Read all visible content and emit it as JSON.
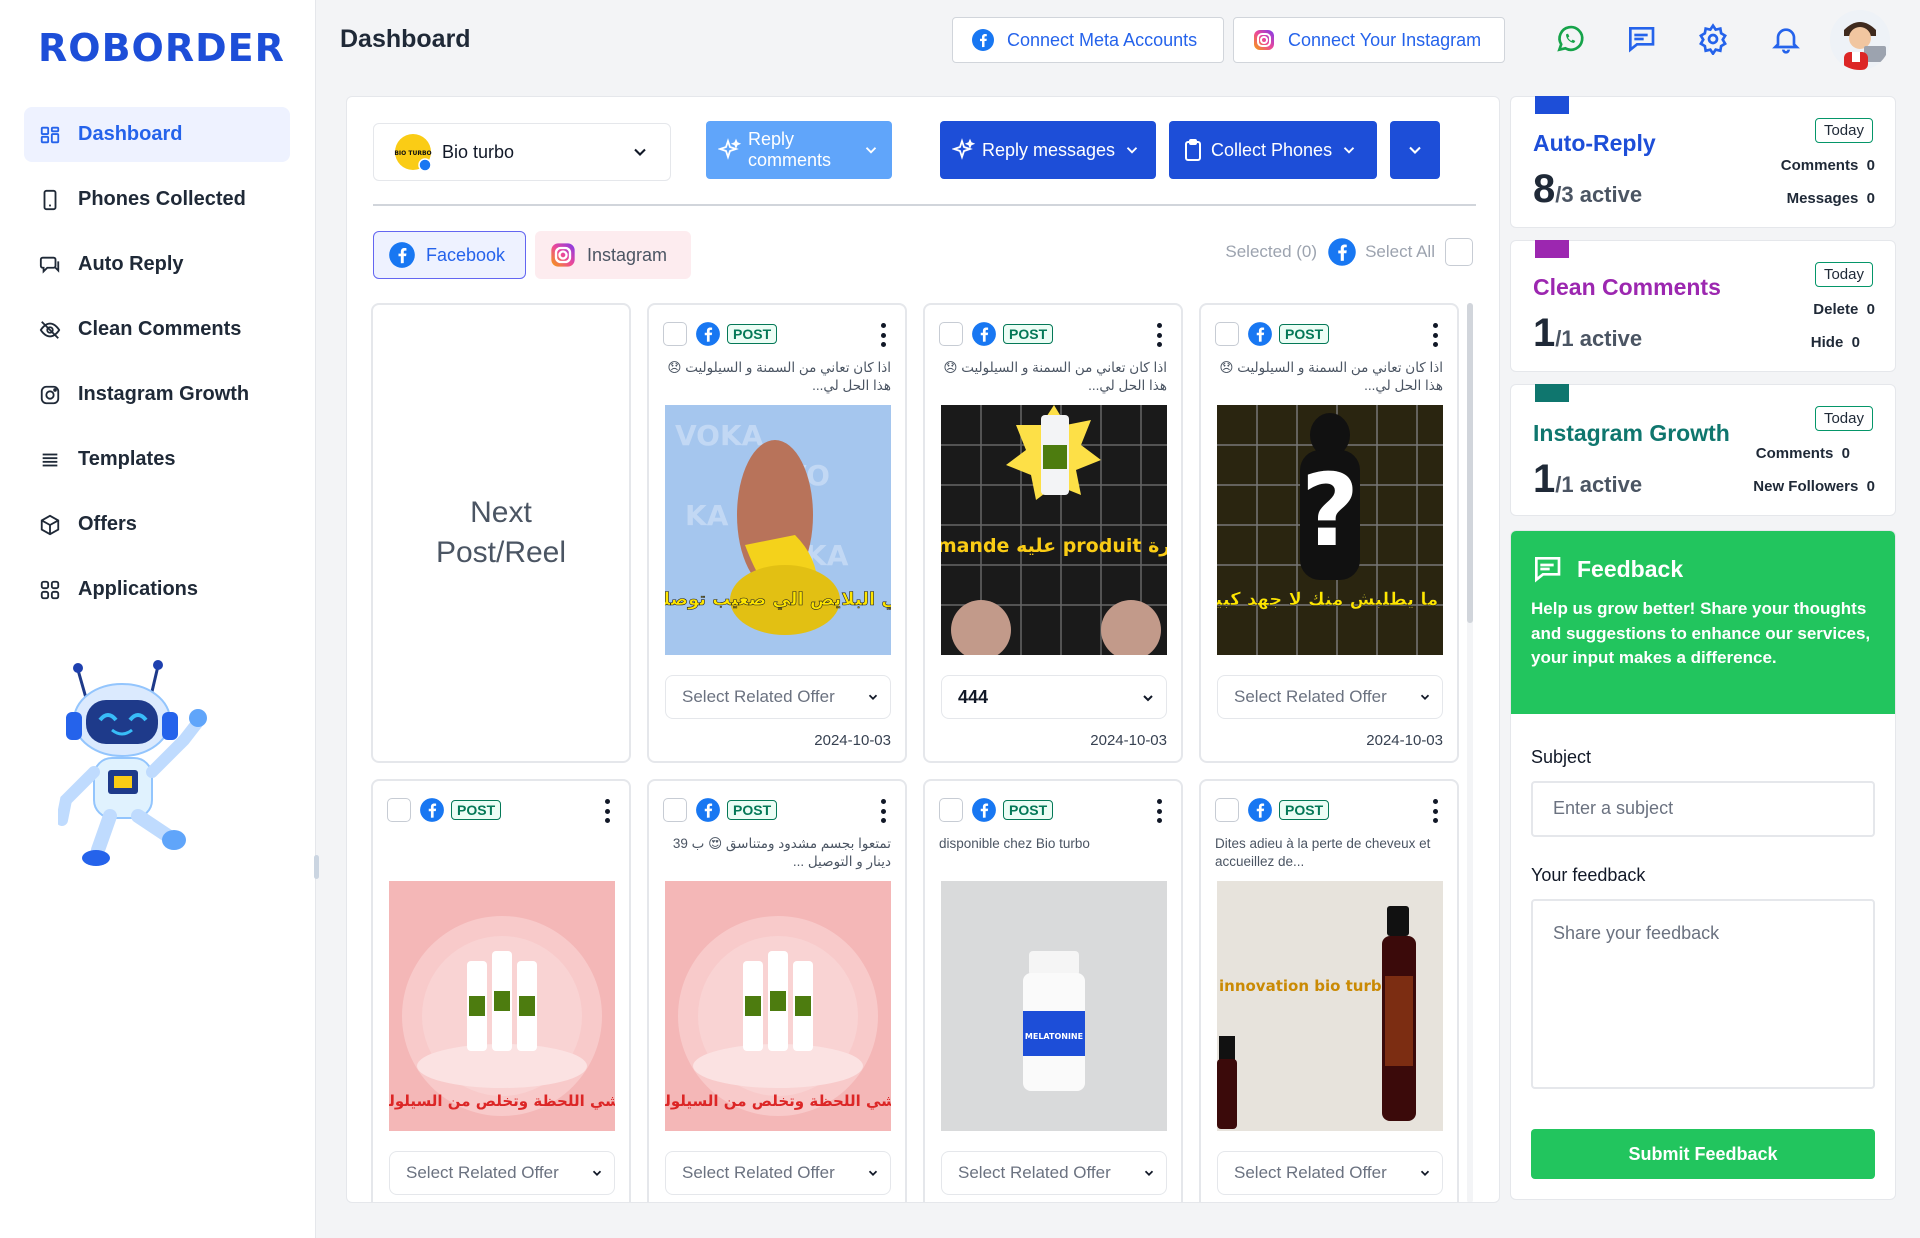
{
  "brand": {
    "name": "ROBORDER"
  },
  "sidebar": {
    "items": [
      {
        "label": "Dashboard",
        "icon": "dashboard-icon",
        "active": true
      },
      {
        "label": "Phones Collected",
        "icon": "phone-icon"
      },
      {
        "label": "Auto Reply",
        "icon": "chat-icon"
      },
      {
        "label": "Clean Comments",
        "icon": "eye-off-icon"
      },
      {
        "label": "Instagram Growth",
        "icon": "instagram-icon"
      },
      {
        "label": "Templates",
        "icon": "list-icon"
      },
      {
        "label": "Offers",
        "icon": "box-icon"
      },
      {
        "label": "Applications",
        "icon": "apps-icon"
      }
    ]
  },
  "header": {
    "title": "Dashboard",
    "connect_meta": "Connect Meta Accounts",
    "connect_instagram": "Connect Your Instagram"
  },
  "toolbar": {
    "page_name": "Bio turbo",
    "page_logo_text": "BIO TURBO",
    "reply_comments": "Reply comments",
    "reply_messages": "Reply messages",
    "collect_phones": "Collect Phones"
  },
  "tabs": {
    "facebook": "Facebook",
    "instagram": "Instagram"
  },
  "selection": {
    "selected": "Selected (0)",
    "select_all": "Select All"
  },
  "next_card": {
    "line1": "Next",
    "line2": "Post/Reel"
  },
  "posts": [
    {
      "badge": "POST",
      "caption": "اذا كان تعاني من السمنة و السيلوليت 😞 هذا الحل لي...",
      "thumb_text": "في البلايص الي صعيب توصلها",
      "offer": "Select Related Offer",
      "date": "2024-10-03"
    },
    {
      "badge": "POST",
      "caption": "اذا كان تعاني من السمنة و السيلوليت 😞 هذا الحل لي...",
      "thumb_text": "demande عليه produit كبيرة",
      "offer": "444",
      "date": "2024-10-03"
    },
    {
      "badge": "POST",
      "caption": "اذا كان تعاني من السمنة و السيلوليت 😞 هذا الحل لي...",
      "thumb_text": "و ما يطلبش منك لا جهد كبير",
      "offer": "Select Related Offer",
      "date": "2024-10-03"
    },
    {
      "badge": "POST",
      "caption": "",
      "thumb_text": "عيشي اللحظة وتخلص من السيلوليت",
      "offer": "Select Related Offer"
    },
    {
      "badge": "POST",
      "caption": "تمتعوا بجسم مشدود ومتناسق 😍 ب 39 دينار و التوصيل ...",
      "thumb_text": "عيشي اللحظة وتخلص من السيلوليت",
      "offer": "Select Related Offer"
    },
    {
      "badge": "POST",
      "caption": "disponible chez Bio turbo",
      "thumb_text": "MELATONINE",
      "offer": "Select Related Offer"
    },
    {
      "badge": "POST",
      "caption": "Dites adieu à la perte de cheveux et accueillez de...",
      "thumb_text": "innovation bio turbo",
      "offer": "Select Related Offer"
    }
  ],
  "stats": {
    "auto_reply": {
      "title": "Auto-Reply",
      "big": "8",
      "small": "/3 active",
      "today": "Today",
      "k1": "Comments",
      "v1": "0",
      "k2": "Messages",
      "v2": "0",
      "color": "#1d4ed8"
    },
    "clean_comments": {
      "title": "Clean Comments",
      "big": "1",
      "small": "/1 active",
      "today": "Today",
      "k1": "Delete",
      "v1": "0",
      "k2": "Hide",
      "v2": "0",
      "color": "#9c27b0"
    },
    "instagram_growth": {
      "title": "Instagram Growth",
      "big": "1",
      "small": "/1 active",
      "today": "Today",
      "k1": "Comments",
      "v1": "0",
      "k2": "New Followers",
      "v2": "0",
      "color": "#0f766e"
    }
  },
  "feedback": {
    "title": "Feedback",
    "description": "Help us grow better! Share your thoughts and suggestions to enhance our services, your input makes a difference.",
    "subject_label": "Subject",
    "subject_placeholder": "Enter a subject",
    "feedback_label": "Your feedback",
    "feedback_placeholder": "Share your feedback",
    "submit": "Submit Feedback"
  },
  "colors": {
    "primary": "#2563eb",
    "green": "#22c55e",
    "reply_comments_bg": "#60a5fa"
  }
}
